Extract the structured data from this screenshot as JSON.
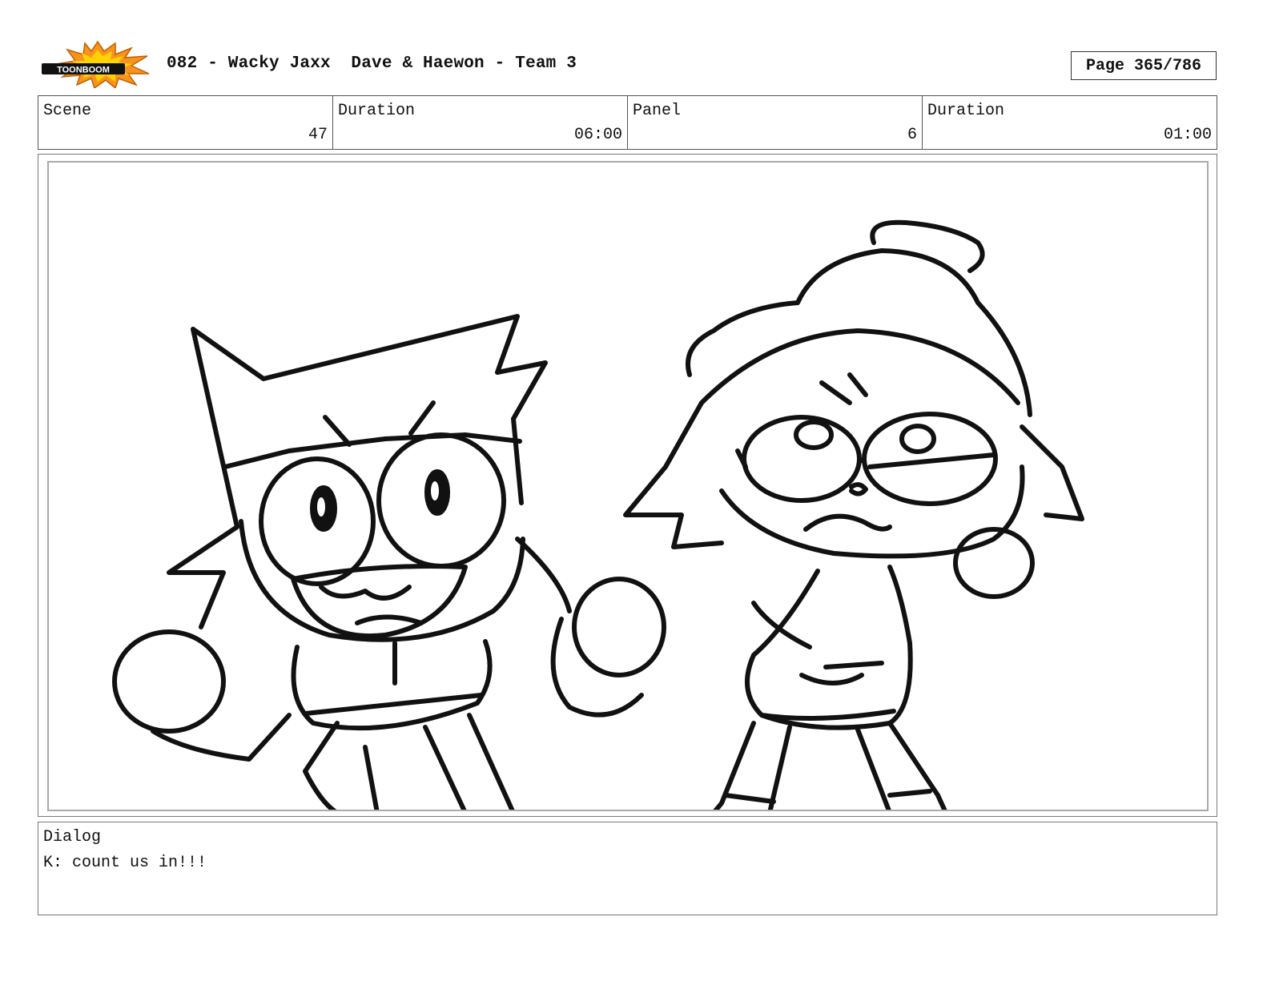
{
  "header": {
    "logo_text": "TOONBOOM",
    "title": "082 - Wacky Jaxx  Dave & Haewon - Team 3",
    "page": "Page 365/786"
  },
  "info": {
    "scene_label": "Scene",
    "scene_value": "47",
    "scene_duration_label": "Duration",
    "scene_duration_value": "06:00",
    "panel_label": "Panel",
    "panel_value": "6",
    "panel_duration_label": "Duration",
    "panel_duration_value": "01:00"
  },
  "dialog": {
    "label": "Dialog",
    "text": "K: count us in!!!"
  },
  "icons": {
    "logo": "toonboom-logo-icon"
  },
  "colors": {
    "logo_orange": "#f7941d",
    "logo_yellow": "#ffd200",
    "ink": "#111111"
  }
}
